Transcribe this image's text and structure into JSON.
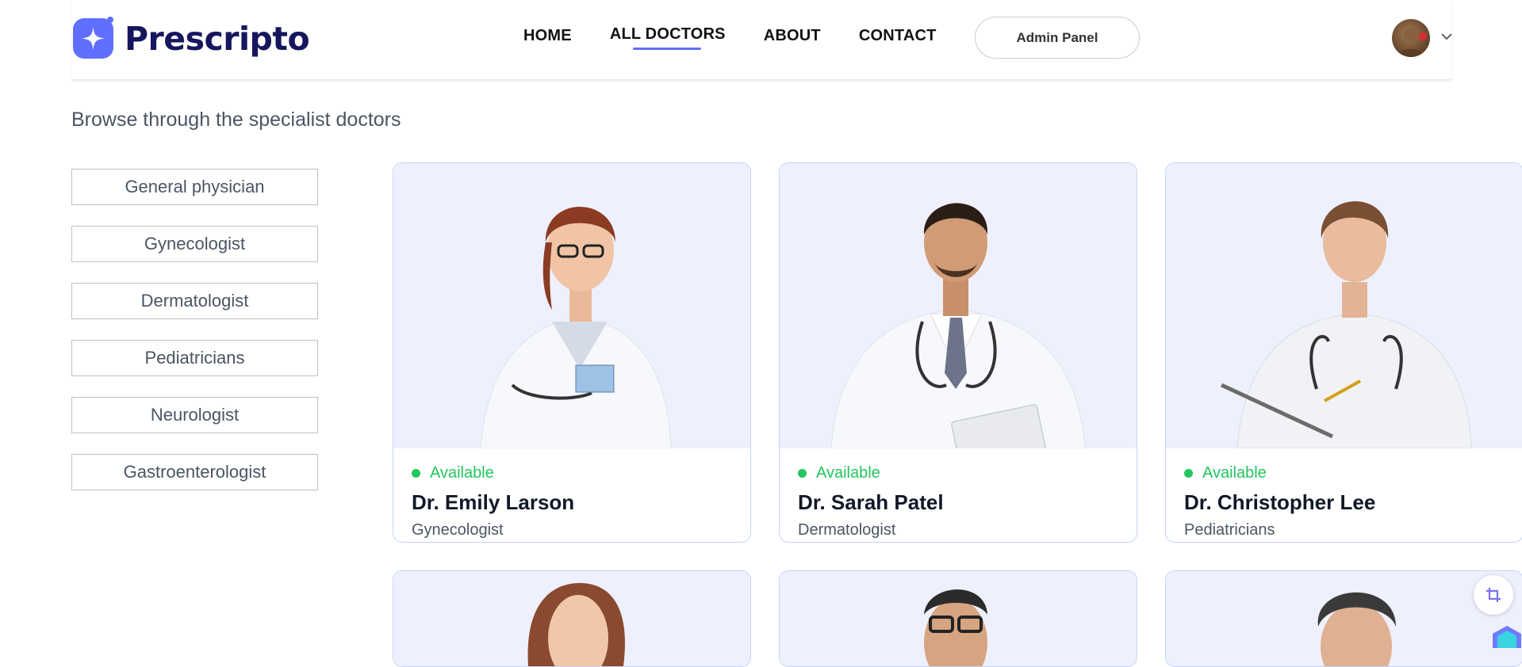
{
  "brand": {
    "name": "Prescripto",
    "accent": "#5f6fff"
  },
  "nav": {
    "items": [
      "HOME",
      "ALL DOCTORS",
      "ABOUT",
      "CONTACT"
    ],
    "active": "ALL DOCTORS",
    "admin_label": "Admin Panel"
  },
  "page": {
    "subtitle": "Browse through the specialist doctors"
  },
  "filters": [
    "General physician",
    "Gynecologist",
    "Dermatologist",
    "Pediatricians",
    "Neurologist",
    "Gastroenterologist"
  ],
  "doctors": [
    {
      "name": "Dr. Emily Larson",
      "speciality": "Gynecologist",
      "status": "Available"
    },
    {
      "name": "Dr. Sarah Patel",
      "speciality": "Dermatologist",
      "status": "Available"
    },
    {
      "name": "Dr. Christopher Lee",
      "speciality": "Pediatricians",
      "status": "Available"
    }
  ],
  "colors": {
    "available": "#22c55e",
    "card_bg": "#eff0fe",
    "card_border": "#c7d3f5"
  },
  "icons": [
    "chevron-down-icon",
    "crop-icon",
    "gem-icon"
  ]
}
